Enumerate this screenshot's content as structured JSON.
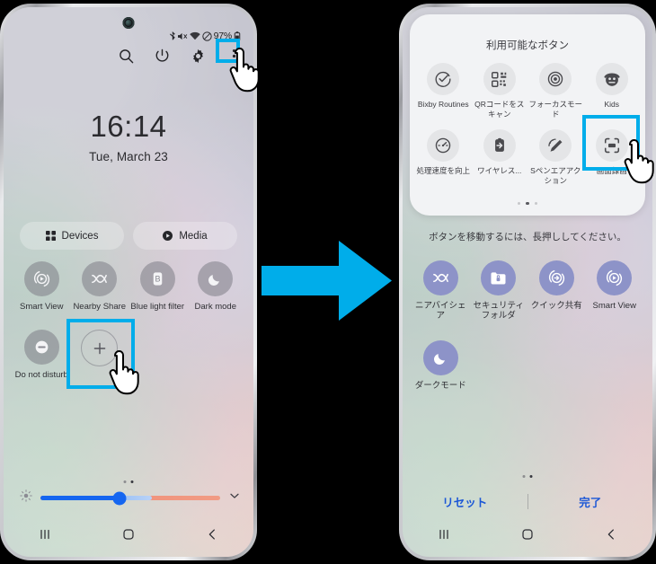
{
  "meta": {
    "arrow_color": "#00adea",
    "highlight_color": "#00adea",
    "accent_blue": "#1a56d6",
    "active_toggle_color": "#8d93c8"
  },
  "left_phone": {
    "status_bar": {
      "battery_percent": "97%",
      "icons": [
        "bluetooth-icon",
        "mute-icon",
        "wifi-icon",
        "do-not-disturb-icon",
        "battery-icon"
      ]
    },
    "header_icons": [
      "search-icon",
      "power-icon",
      "settings-icon",
      "more-options-icon"
    ],
    "clock": {
      "time": "16:14",
      "date": "Tue, March 23"
    },
    "pills": [
      {
        "label": "Devices",
        "icon": "devices-grid-icon"
      },
      {
        "label": "Media",
        "icon": "media-play-icon"
      }
    ],
    "toggles_row1": [
      {
        "label": "Smart View",
        "icon": "smart-view-icon"
      },
      {
        "label": "Nearby Share",
        "icon": "nearby-share-icon"
      },
      {
        "label": "Blue light filter",
        "icon": "blue-light-filter-icon"
      },
      {
        "label": "Dark mode",
        "icon": "dark-mode-icon"
      }
    ],
    "toggles_row2": [
      {
        "label": "Do not disturb",
        "icon": "do-not-disturb-icon"
      },
      {
        "label": "",
        "icon": "add-button-icon"
      }
    ],
    "brightness": {
      "icon": "brightness-icon",
      "value_percent": 44,
      "expand_icon": "chevron-down-icon"
    },
    "page_dots": {
      "count": 2,
      "active_index": 1
    },
    "nav_bar": [
      "recents-icon",
      "home-icon",
      "back-icon"
    ]
  },
  "right_phone": {
    "sheet": {
      "title": "利用可能なボタン",
      "row1": [
        {
          "label": "Bixby Routines",
          "icon": "bixby-routines-icon"
        },
        {
          "label": "QRコードをスキャン",
          "icon": "qr-code-icon"
        },
        {
          "label": "フォーカスモード",
          "icon": "focus-mode-icon"
        },
        {
          "label": "Kids",
          "icon": "kids-mode-icon"
        }
      ],
      "row2": [
        {
          "label": "処理速度を向上",
          "icon": "speed-boost-icon"
        },
        {
          "label": "ワイヤレス...",
          "icon": "wireless-powershare-icon"
        },
        {
          "label": "Sペンエアアクション",
          "icon": "spen-air-action-icon"
        },
        {
          "label": "画面録画",
          "icon": "screen-recorder-icon"
        }
      ],
      "page_dots": {
        "count": 3,
        "active_index": 1
      }
    },
    "hint": "ボタンを移動するには、長押ししてください。",
    "toggles_row1": [
      {
        "label": "ニアバイシェア",
        "icon": "nearby-share-icon"
      },
      {
        "label": "セキュリティフォルダ",
        "icon": "secure-folder-icon"
      },
      {
        "label": "クイック共有",
        "icon": "quick-share-icon"
      },
      {
        "label": "Smart View",
        "icon": "smart-view-icon"
      }
    ],
    "toggles_row2": [
      {
        "label": "ダークモード",
        "icon": "dark-mode-icon"
      }
    ],
    "actions": {
      "reset_label": "リセット",
      "done_label": "完了"
    },
    "page_dots": {
      "count": 2,
      "active_index": 1
    },
    "nav_bar": [
      "recents-icon",
      "home-icon",
      "back-icon"
    ]
  }
}
